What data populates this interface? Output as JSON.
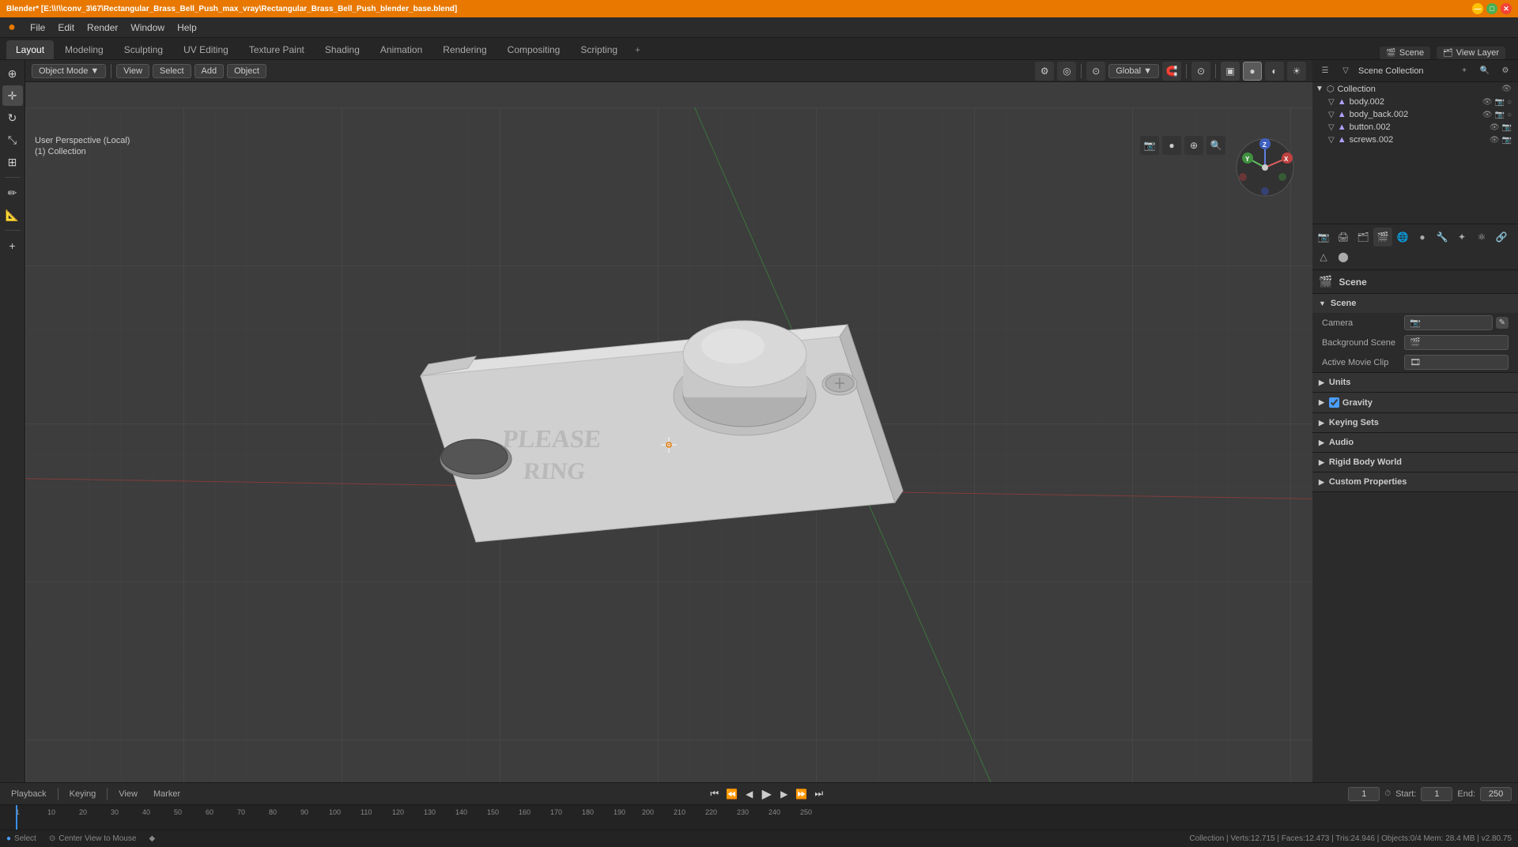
{
  "titlebar": {
    "title": "Blender* [E:\\\\!\\\\conv_3\\67\\Rectangular_Brass_Bell_Push_max_vray\\Rectangular_Brass_Bell_Push_blender_base.blend]",
    "app": "Blender*"
  },
  "menubar": {
    "items": [
      "Blender",
      "File",
      "Edit",
      "Render",
      "Window",
      "Help"
    ]
  },
  "workspace_tabs": {
    "tabs": [
      "Layout",
      "Modeling",
      "Sculpting",
      "UV Editing",
      "Texture Paint",
      "Shading",
      "Animation",
      "Rendering",
      "Compositing",
      "Scripting"
    ],
    "active": "Layout",
    "plus": "+"
  },
  "viewport": {
    "mode": "Object Mode",
    "view_label": "User Perspective (Local)",
    "collection_label": "(1) Collection",
    "transform": "Global",
    "header_icons": [
      "cursor",
      "move",
      "scale",
      "rotate",
      "transform",
      "pin",
      "sphere",
      "dot"
    ],
    "shading_icons": [
      "wireframe",
      "solid",
      "material",
      "render"
    ]
  },
  "outliner": {
    "title": "Scene Collection",
    "items": [
      {
        "name": "Collection",
        "indent": 0,
        "icon": "▼",
        "has_eye": true
      },
      {
        "name": "body.002",
        "indent": 1,
        "icon": "▽",
        "has_eye": true,
        "has_cam": true,
        "has_render": true
      },
      {
        "name": "body_back.002",
        "indent": 1,
        "icon": "▽",
        "has_eye": true,
        "has_cam": true,
        "has_render": true
      },
      {
        "name": "button.002",
        "indent": 1,
        "icon": "▽",
        "has_eye": true,
        "has_cam": true
      },
      {
        "name": "screws.002",
        "indent": 1,
        "icon": "▽",
        "has_eye": true,
        "has_cam": true
      }
    ]
  },
  "scene_props": {
    "title": "Scene",
    "name": "Scene",
    "sections": [
      {
        "name": "scene-section",
        "label": "Scene",
        "expanded": true,
        "rows": [
          {
            "label": "Camera",
            "value": "",
            "icon": "📷"
          },
          {
            "label": "Background Scene",
            "value": "",
            "icon": "🎬"
          },
          {
            "label": "Active Movie Clip",
            "value": "",
            "icon": "🎞"
          }
        ]
      },
      {
        "name": "units-section",
        "label": "Units",
        "expanded": false,
        "rows": []
      },
      {
        "name": "gravity-section",
        "label": "Gravity",
        "expanded": false,
        "rows": [],
        "checkbox": true
      },
      {
        "name": "keying-sets-section",
        "label": "Keying Sets",
        "expanded": false,
        "rows": []
      },
      {
        "name": "audio-section",
        "label": "Audio",
        "expanded": false,
        "rows": []
      },
      {
        "name": "rigid-body-section",
        "label": "Rigid Body World",
        "expanded": false,
        "rows": []
      },
      {
        "name": "custom-props-section",
        "label": "Custom Properties",
        "expanded": false,
        "rows": []
      }
    ]
  },
  "header_right": {
    "view_layer": "View Layer",
    "scene": "Scene"
  },
  "timeline": {
    "playback": "Playback",
    "keying": "Keying",
    "view": "View",
    "marker": "Marker",
    "current_frame": "1",
    "start": "1",
    "end": "250",
    "start_label": "Start:",
    "end_label": "End:",
    "frame_markers": [
      "1",
      "10",
      "20",
      "30",
      "40",
      "50",
      "60",
      "70",
      "80",
      "90",
      "100",
      "110",
      "120",
      "130",
      "140",
      "150",
      "160",
      "170",
      "180",
      "190",
      "200",
      "210",
      "220",
      "230",
      "240",
      "250"
    ]
  },
  "statusbar": {
    "left": "Select",
    "center": "Center View to Mouse",
    "right": "Collection | Verts:12.715 | Faces:12.473 | Tris:24.946 | Objects:0/4  Mem: 28.4 MB | v2.80.75"
  },
  "left_tools": [
    {
      "name": "cursor-tool",
      "icon": "⊕",
      "active": false
    },
    {
      "name": "move-tool",
      "icon": "✛",
      "active": true
    },
    {
      "name": "rotate-tool",
      "icon": "↻",
      "active": false
    },
    {
      "name": "scale-tool",
      "icon": "⤡",
      "active": false
    },
    {
      "name": "transform-tool",
      "icon": "⊞",
      "active": false
    },
    {
      "separator": true
    },
    {
      "name": "annotate-tool",
      "icon": "✏",
      "active": false
    },
    {
      "name": "measure-tool",
      "icon": "📏",
      "active": false
    }
  ],
  "colors": {
    "accent": "#e87800",
    "bg_dark": "#232323",
    "bg_mid": "#2b2b2b",
    "bg_light": "#3d3d3d",
    "border": "#1a1a1a",
    "text": "#cccccc",
    "text_dim": "#888888"
  }
}
